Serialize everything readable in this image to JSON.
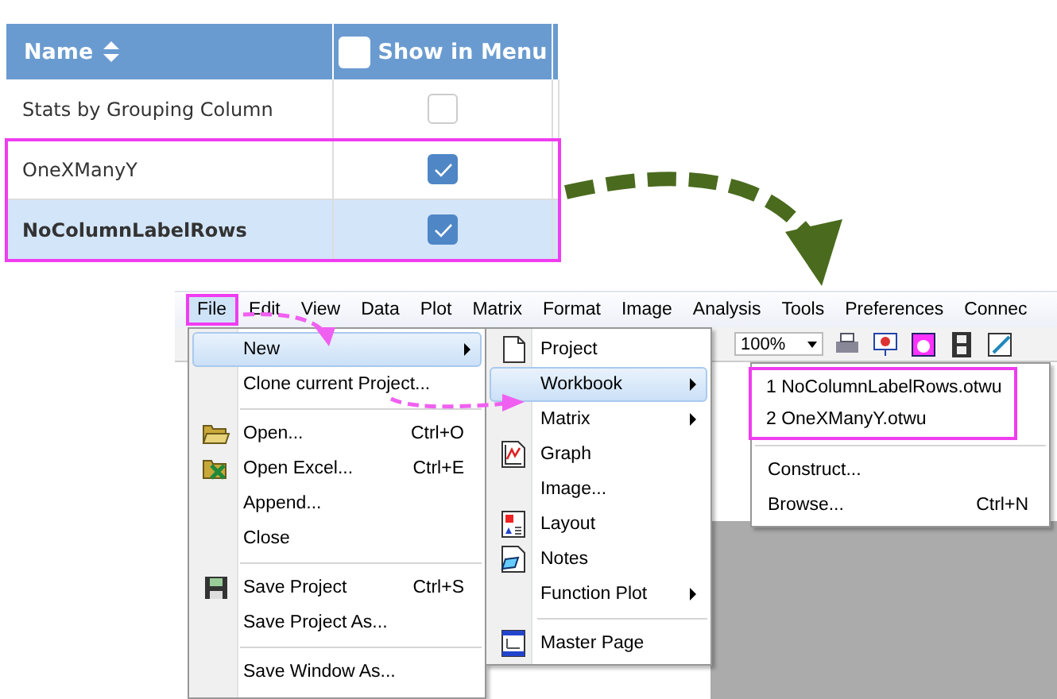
{
  "table": {
    "columns": [
      {
        "label": "Name",
        "sortable": true
      },
      {
        "label": "Show in Menu",
        "checked": false
      }
    ],
    "rows": [
      {
        "name": "Stats by Grouping Column",
        "show_in_menu": false,
        "selected": false,
        "highlighted": false
      },
      {
        "name": "OneXManyY",
        "show_in_menu": true,
        "selected": false,
        "highlighted": true
      },
      {
        "name": "NoColumnLabelRows",
        "show_in_menu": true,
        "selected": true,
        "highlighted": true
      }
    ]
  },
  "menu_bar": {
    "items": [
      {
        "label": "File",
        "selected": true
      },
      {
        "label": "Edit",
        "selected": false
      },
      {
        "label": "View",
        "selected": false
      },
      {
        "label": "Data",
        "selected": false
      },
      {
        "label": "Plot",
        "selected": false
      },
      {
        "label": "Matrix",
        "selected": false
      },
      {
        "label": "Format",
        "selected": false
      },
      {
        "label": "Image",
        "selected": false
      },
      {
        "label": "Analysis",
        "selected": false
      },
      {
        "label": "Tools",
        "selected": false
      },
      {
        "label": "Preferences",
        "selected": false
      },
      {
        "label": "Connec",
        "selected": false
      }
    ]
  },
  "toolbar": {
    "zoom": "100%"
  },
  "file_menu": {
    "items": [
      {
        "kind": "item",
        "label": "New",
        "submenu": true,
        "selected": true
      },
      {
        "kind": "item",
        "label": "Clone current Project...",
        "selected": false
      },
      {
        "kind": "separator"
      },
      {
        "kind": "item",
        "label": "Open...",
        "shortcut": "Ctrl+O",
        "selected": false
      },
      {
        "kind": "item",
        "label": "Open Excel...",
        "shortcut": "Ctrl+E",
        "selected": false
      },
      {
        "kind": "item",
        "label": "Append...",
        "selected": false
      },
      {
        "kind": "item",
        "label": "Close",
        "selected": false
      },
      {
        "kind": "separator"
      },
      {
        "kind": "item",
        "label": "Save Project",
        "shortcut": "Ctrl+S",
        "selected": false
      },
      {
        "kind": "item",
        "label": "Save Project As...",
        "selected": false
      },
      {
        "kind": "separator"
      },
      {
        "kind": "item",
        "label": "Save Window As...",
        "selected": false
      }
    ]
  },
  "new_submenu": {
    "items": [
      {
        "kind": "item",
        "label": "Project",
        "selected": false
      },
      {
        "kind": "item",
        "label": "Workbook",
        "submenu": true,
        "selected": true
      },
      {
        "kind": "item",
        "label": "Matrix",
        "submenu": true,
        "selected": false
      },
      {
        "kind": "item",
        "label": "Graph",
        "selected": false
      },
      {
        "kind": "item",
        "label": "Image...",
        "selected": false
      },
      {
        "kind": "item",
        "label": "Layout",
        "selected": false
      },
      {
        "kind": "item",
        "label": "Notes",
        "selected": false
      },
      {
        "kind": "item",
        "label": "Function Plot",
        "submenu": true,
        "selected": false
      },
      {
        "kind": "separator"
      },
      {
        "kind": "item",
        "label": "Master Page",
        "selected": false
      }
    ]
  },
  "workbook_submenu": {
    "items": [
      {
        "kind": "item",
        "label": "1 NoColumnLabelRows.otwu",
        "selected": false,
        "highlighted": true
      },
      {
        "kind": "item",
        "label": "2 OneXManyY.otwu",
        "selected": false,
        "highlighted": true
      },
      {
        "kind": "separator"
      },
      {
        "kind": "item",
        "label": "Construct...",
        "selected": false,
        "highlighted": false
      },
      {
        "kind": "item",
        "label": "Browse...",
        "shortcut": "Ctrl+N",
        "selected": false,
        "highlighted": false
      }
    ]
  }
}
